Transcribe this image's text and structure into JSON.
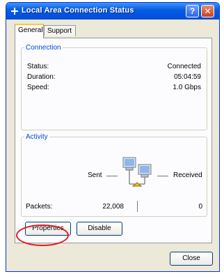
{
  "window": {
    "title": "Local Area Connection Status",
    "help_label": "?",
    "close_glyph": "✕"
  },
  "tabs": [
    {
      "label": "General",
      "active": true
    },
    {
      "label": "Support",
      "active": false
    }
  ],
  "connection": {
    "legend": "Connection",
    "rows": [
      {
        "key": "Status:",
        "value": "Connected"
      },
      {
        "key": "Duration:",
        "value": "05:04:59"
      },
      {
        "key": "Speed:",
        "value": "1.0 Gbps"
      }
    ]
  },
  "activity": {
    "legend": "Activity",
    "sent_label": "Sent",
    "received_label": "Received",
    "packets_label": "Packets:",
    "packets_sent": "22,008",
    "packets_received": "0",
    "icon": "network-activity-icon"
  },
  "buttons": {
    "properties": "Properties",
    "disable": "Disable",
    "close": "Close"
  },
  "colors": {
    "title_bar": "#0054e3",
    "group_legend": "#0046d5",
    "highlight_circle": "#e01b22",
    "dialog_bg": "#ece9d8"
  }
}
